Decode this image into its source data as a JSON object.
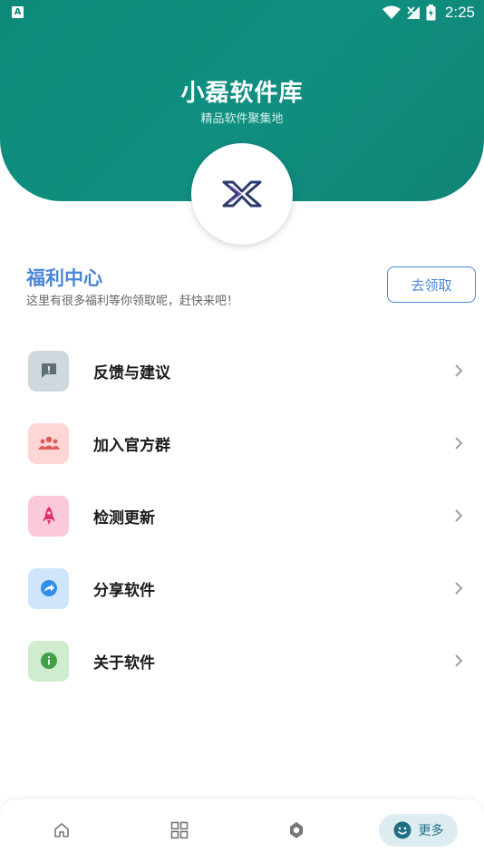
{
  "status_bar": {
    "notification_badge": "A",
    "time": "2:25",
    "icons": [
      "wifi-icon",
      "no-signal-icon",
      "battery-icon"
    ]
  },
  "header": {
    "title": "小磊软件库",
    "subtitle": "精品软件聚集地",
    "background_color": "#0f8a7b"
  },
  "welfare": {
    "title": "福利中心",
    "description": "这里有很多福利等你领取呢，赶快来吧！",
    "button_label": "去领取",
    "accent_color": "#4a86d8"
  },
  "menu": {
    "items": [
      {
        "label": "反馈与建议",
        "icon": "feedback-icon",
        "icon_bg": "#cfd8dc",
        "icon_color": "#5f6f78"
      },
      {
        "label": "加入官方群",
        "icon": "group-icon",
        "icon_bg": "#ffd6d6",
        "icon_color": "#e05a5a"
      },
      {
        "label": "检测更新",
        "icon": "rocket-icon",
        "icon_bg": "#fbc9dc",
        "icon_color": "#e0306a"
      },
      {
        "label": "分享软件",
        "icon": "share-icon",
        "icon_bg": "#cfe5fb",
        "icon_color": "#2f8fe8"
      },
      {
        "label": "关于软件",
        "icon": "info-icon",
        "icon_bg": "#cfeccf",
        "icon_color": "#43a047"
      }
    ]
  },
  "bottom_nav": {
    "items": [
      {
        "icon": "home-icon"
      },
      {
        "icon": "grid-icon"
      },
      {
        "icon": "discover-icon"
      },
      {
        "icon": "smile-icon",
        "label": "更多",
        "active": true
      }
    ]
  }
}
